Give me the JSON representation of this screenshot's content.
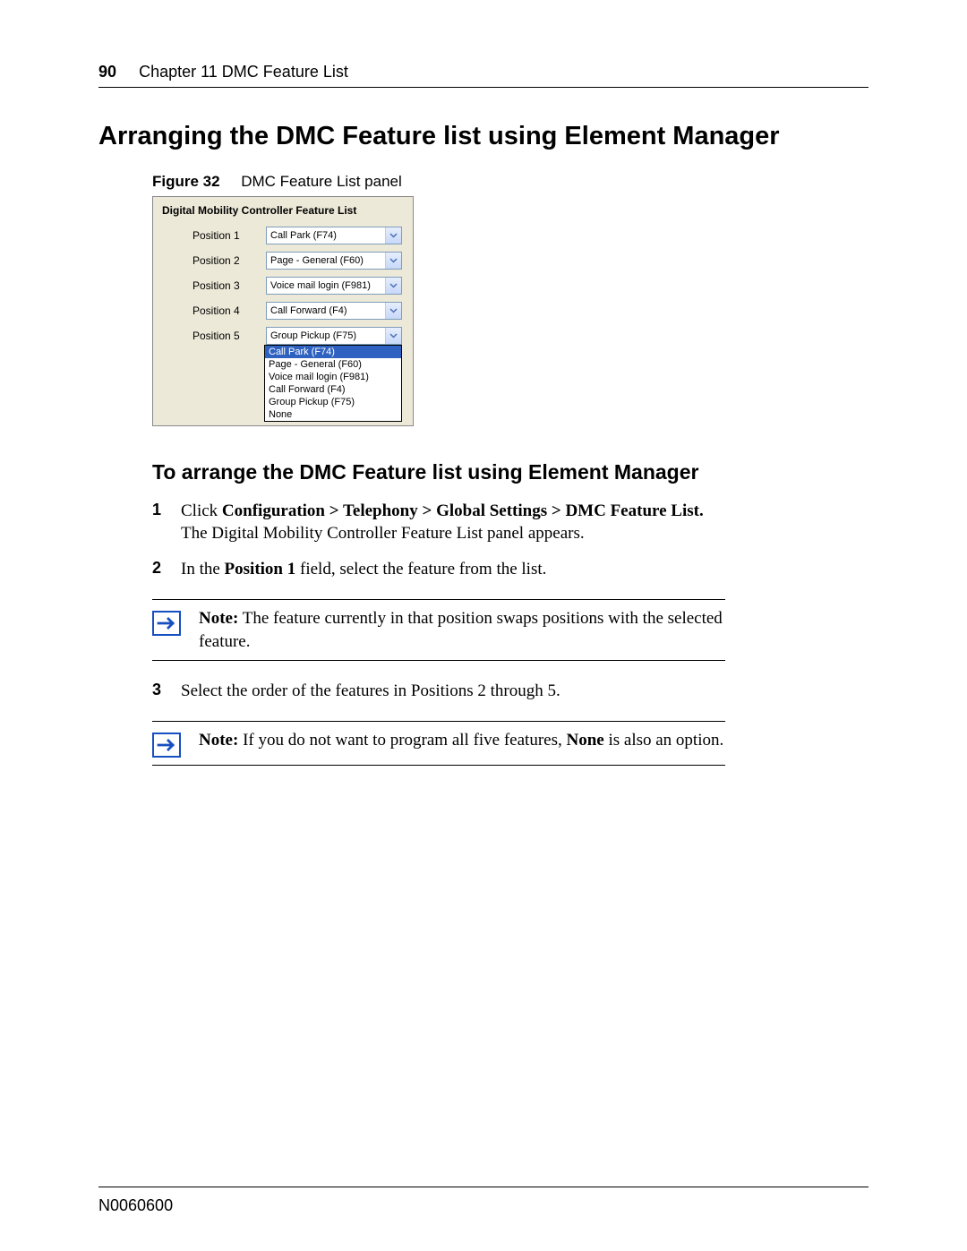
{
  "header": {
    "page_number": "90",
    "chapter": "Chapter 11  DMC Feature List"
  },
  "title": "Arranging the DMC Feature list using Element Manager",
  "figure": {
    "number": "Figure 32",
    "caption": "DMC Feature List panel",
    "panel_title": "Digital Mobility Controller Feature List",
    "positions": [
      {
        "label": "Position 1",
        "value": "Call Park (F74)"
      },
      {
        "label": "Position 2",
        "value": "Page - General (F60)"
      },
      {
        "label": "Position 3",
        "value": "Voice mail login (F981)"
      },
      {
        "label": "Position 4",
        "value": "Call Forward (F4)"
      },
      {
        "label": "Position 5",
        "value": "Group Pickup (F75)"
      }
    ],
    "dropdown_items": [
      "Call Park (F74)",
      "Page - General (F60)",
      "Voice mail login (F981)",
      "Call Forward (F4)",
      "Group Pickup (F75)",
      "None"
    ],
    "dropdown_selected_index": 0
  },
  "subheading": "To arrange the DMC Feature list using Element Manager",
  "steps": {
    "s1": {
      "num": "1",
      "click_word": "Click ",
      "path": "Configuration > Telephony > Global Settings > DMC Feature List.",
      "line2": "The Digital Mobility Controller Feature List panel appears."
    },
    "s2": {
      "num": "2",
      "pre": "In the ",
      "field": "Position 1",
      "post": " field, select the feature from the list."
    },
    "s3": {
      "num": "3",
      "text": "Select the order of the features in Positions 2 through 5."
    }
  },
  "notes": {
    "n1": {
      "label": "Note:",
      "text": " The feature currently in that position swaps positions with the selected feature."
    },
    "n2": {
      "label": "Note:",
      "pre": " If you do not want to program all five features, ",
      "bold": "None",
      "post": " is also an option."
    }
  },
  "footer": {
    "docid": "N0060600"
  }
}
